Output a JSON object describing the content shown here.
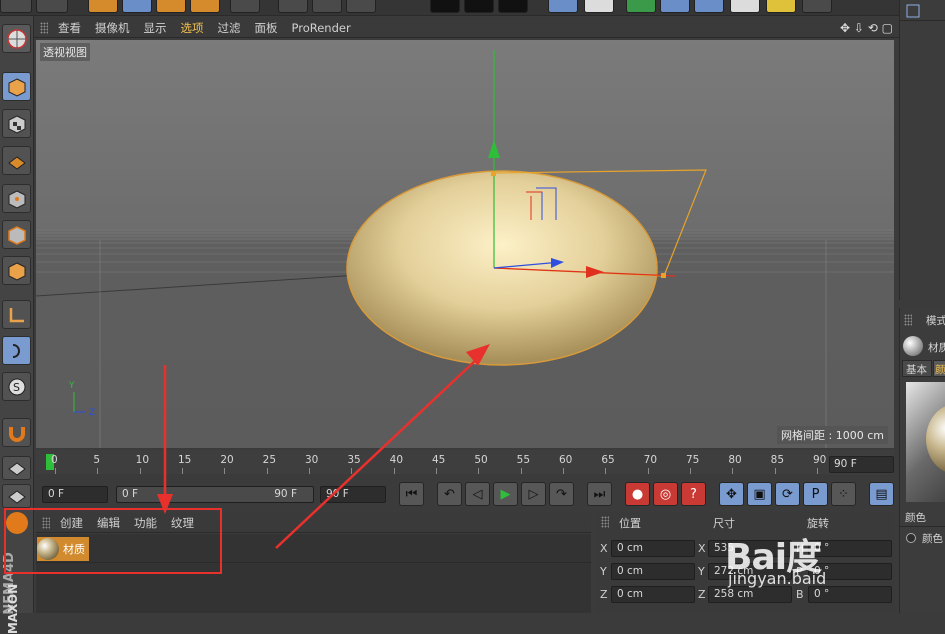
{
  "viewport_menu": {
    "items": [
      "查看",
      "摄像机",
      "显示",
      "选项",
      "过滤",
      "面板",
      "ProRender"
    ],
    "active_index": 3
  },
  "viewport": {
    "label": "透视视图",
    "grid_readout": "网格间距 : 1000 cm"
  },
  "timeline": {
    "ticks": [
      "0",
      "5",
      "10",
      "15",
      "20",
      "25",
      "30",
      "35",
      "40",
      "45",
      "50",
      "55",
      "60",
      "65",
      "70",
      "75",
      "80",
      "85",
      "90"
    ],
    "current_frame": "90 F"
  },
  "transport": {
    "start_frame": "0 F",
    "range_start": "0 F",
    "range_end": "90 F",
    "end_frame": "90 F"
  },
  "material_manager": {
    "menu": [
      "创建",
      "编辑",
      "功能",
      "纹理"
    ],
    "material_name": "材质"
  },
  "coordinates": {
    "position_header": "位置",
    "size_header": "尺寸",
    "rotation_header": "旋转",
    "rows": [
      {
        "axis": "X",
        "pos": "0 cm",
        "size_axis": "X",
        "size": "535",
        "rot_axis": "H",
        "rot": "0 °"
      },
      {
        "axis": "Y",
        "pos": "0 cm",
        "size_axis": "Y",
        "size": "272 cm",
        "rot_axis": "P",
        "rot": "0 °"
      },
      {
        "axis": "Z",
        "pos": "0 cm",
        "size_axis": "Z",
        "size": "258 cm",
        "rot_axis": "B",
        "rot": "0 °"
      }
    ]
  },
  "attributes": {
    "mode_label": "模式",
    "material_label": "材质",
    "tab_basic": "基本",
    "tab_color": "颜",
    "color_heading": "颜色",
    "color_option": "颜色"
  },
  "side_labels": {
    "brand_vertical": "NEMA4D",
    "brand_vertical2": "MAXON"
  },
  "watermark": {
    "logo": "Bai度",
    "site": "jingyan.baid"
  },
  "colors": {
    "accent_orange": "#d18b2e",
    "annotation_red": "#e8312d",
    "active_menu": "#f2c14e",
    "selection_blue": "#7a9bd0"
  }
}
